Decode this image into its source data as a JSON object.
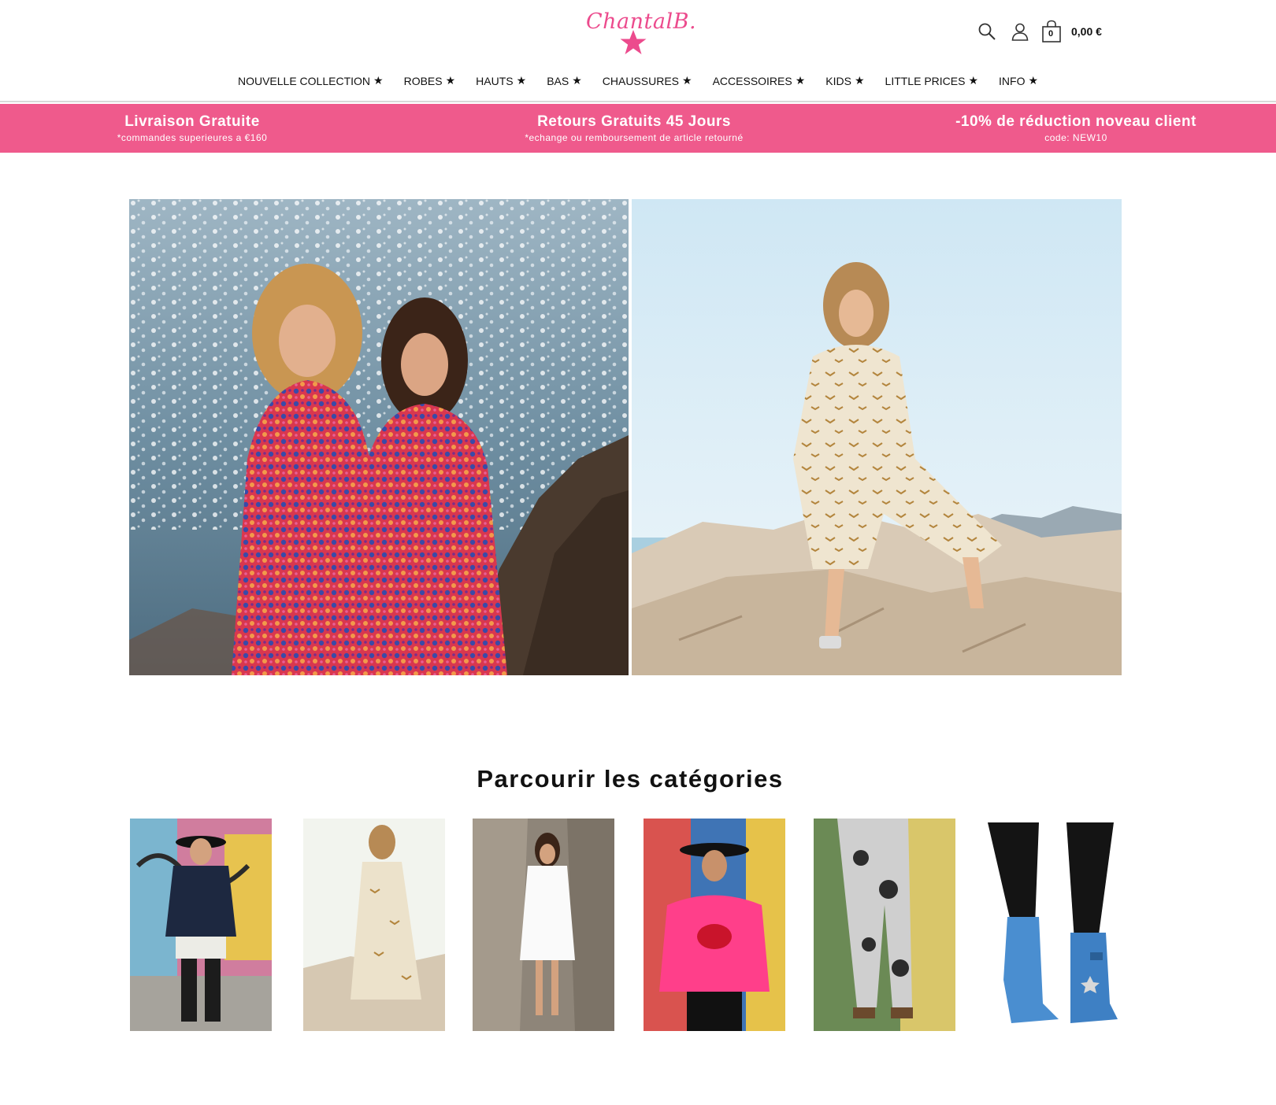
{
  "brand": {
    "name": "Chantal",
    "mark": "B."
  },
  "header": {
    "cart_count": "0",
    "cart_total": "0,00 €",
    "icons": [
      "search-icon",
      "user-icon",
      "shopping-bag-icon"
    ]
  },
  "nav": {
    "items": [
      {
        "label": "NOUVELLE COLLECTION"
      },
      {
        "label": "ROBES"
      },
      {
        "label": "HAUTS"
      },
      {
        "label": "BAS"
      },
      {
        "label": "CHAUSSURES"
      },
      {
        "label": "ACCESSOIRES"
      },
      {
        "label": "KIDS"
      },
      {
        "label": "LITTLE PRICES"
      },
      {
        "label": "INFO"
      }
    ],
    "star": "★"
  },
  "promo": {
    "items": [
      {
        "title": "Livraison Gratuite",
        "sub": "*commandes superieures a €160"
      },
      {
        "title": "Retours Gratuits 45 Jours",
        "sub": "*echange ou remboursement de article retourné"
      },
      {
        "title": "-10% de réduction noveau client",
        "sub": "code: NEW10"
      }
    ]
  },
  "categories": {
    "title": "Parcourir les catégories"
  },
  "colors": {
    "accent": "#ef5a8c",
    "logo": "#ec4b8d",
    "text": "#111111"
  }
}
